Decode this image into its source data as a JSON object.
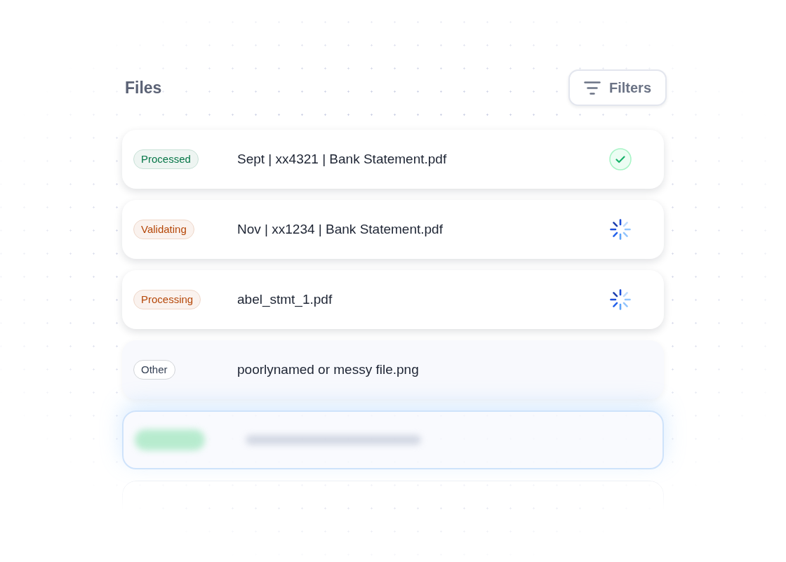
{
  "header": {
    "title": "Files",
    "filter_button": {
      "label": "Filters"
    }
  },
  "rows": [
    {
      "kind": "file",
      "dimmed": false,
      "status": {
        "label": "Processed",
        "color": "#067647"
      },
      "name": "Sept | xx4321 | Bank Statement.pdf",
      "indicator": {
        "kind": "check"
      }
    },
    {
      "kind": "file",
      "dimmed": false,
      "status": {
        "label": "Validating",
        "color": "#b54708"
      },
      "name": "Nov | xx1234 | Bank Statement.pdf",
      "indicator": {
        "kind": "spinner"
      }
    },
    {
      "kind": "file",
      "dimmed": false,
      "status": {
        "label": "Processing",
        "color": "#b54708"
      },
      "name": "abel_stmt_1.pdf",
      "indicator": {
        "kind": "spinner"
      }
    },
    {
      "kind": "file",
      "dimmed": true,
      "status": {
        "label": "Other",
        "color": "#344054"
      },
      "name": "poorlynamed or messy file.png"
    },
    {
      "kind": "blurred"
    },
    {
      "kind": "empty"
    }
  ]
}
